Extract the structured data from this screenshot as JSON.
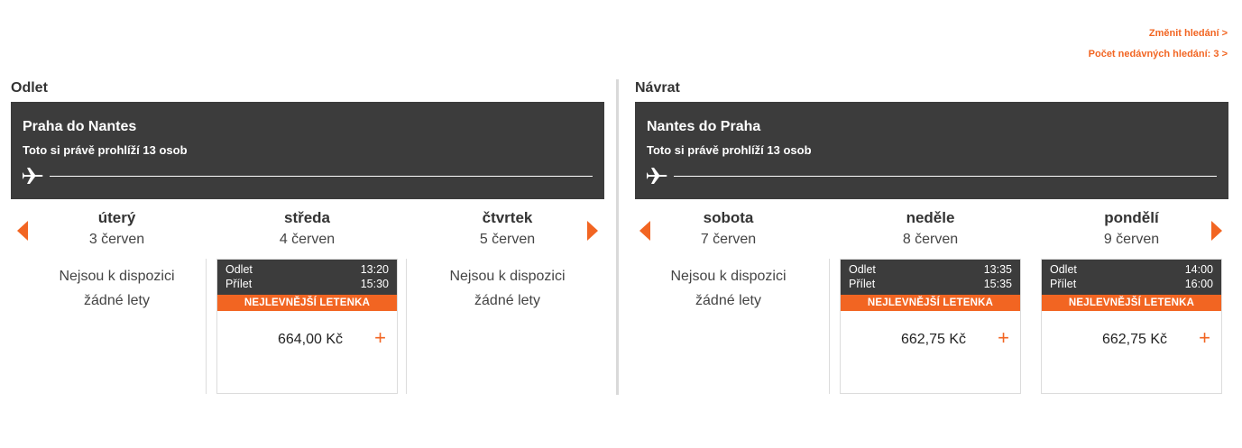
{
  "links": {
    "change_search": "Změnit hledání >",
    "recent_searches": "Počet nedávných hledání: 3 >"
  },
  "outbound": {
    "title": "Odlet",
    "route": "Praha do Nantes",
    "viewers": "Toto si právě prohlíží 13 osob",
    "days": [
      {
        "name": "úterý",
        "date": "3 červen",
        "no_flights_1": "Nejsou k dispozici",
        "no_flights_2": "žádné lety"
      },
      {
        "name": "středa",
        "date": "4 červen",
        "flight": {
          "dep_label": "Odlet",
          "dep_time": "13:20",
          "arr_label": "Přílet",
          "arr_time": "15:30",
          "badge": "NEJLEVNĚJŠÍ LETENKA",
          "price": "664,00 Kč"
        }
      },
      {
        "name": "čtvrtek",
        "date": "5 červen",
        "no_flights_1": "Nejsou k dispozici",
        "no_flights_2": "žádné lety"
      }
    ]
  },
  "return": {
    "title": "Návrat",
    "route": "Nantes do Praha",
    "viewers": "Toto si právě prohlíží 13 osob",
    "days": [
      {
        "name": "sobota",
        "date": "7 červen",
        "no_flights_1": "Nejsou k dispozici",
        "no_flights_2": "žádné lety"
      },
      {
        "name": "neděle",
        "date": "8 červen",
        "flight": {
          "dep_label": "Odlet",
          "dep_time": "13:35",
          "arr_label": "Přílet",
          "arr_time": "15:35",
          "badge": "NEJLEVNĚJŠÍ LETENKA",
          "price": "662,75 Kč"
        }
      },
      {
        "name": "pondělí",
        "date": "9 červen",
        "flight": {
          "dep_label": "Odlet",
          "dep_time": "14:00",
          "arr_label": "Přílet",
          "arr_time": "16:00",
          "badge": "NEJLEVNĚJŠÍ LETENKA",
          "price": "662,75 Kč"
        }
      }
    ]
  },
  "icons": {
    "plane": "airplane-icon",
    "prev": "chevron-left-icon",
    "next": "chevron-right-icon",
    "add": "plus-icon"
  },
  "colors": {
    "accent": "#f26522",
    "header_bg": "#3c3c3c"
  }
}
